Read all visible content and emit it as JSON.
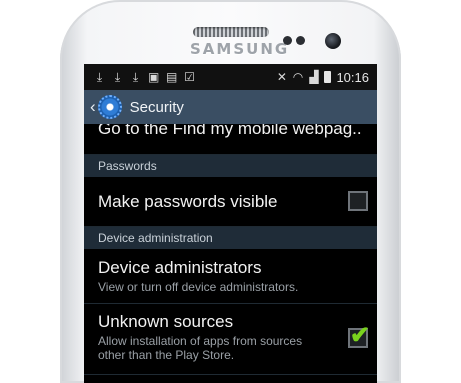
{
  "device": {
    "brand": "SAMSUNG"
  },
  "status_bar": {
    "time": "10:16",
    "left_icons": [
      "download-icon",
      "download-icon",
      "download-icon",
      "image-icon",
      "bag-icon",
      "clipboard-check-icon"
    ],
    "right_icons": [
      "mute-icon",
      "wifi-icon",
      "signal-icon",
      "battery-icon"
    ]
  },
  "action_bar": {
    "title": "Security",
    "accent": "#3a4e63"
  },
  "list": {
    "partial_item": "Go to the Find my mobile webpag..",
    "sections": [
      {
        "header": "Passwords"
      },
      {
        "header": "Device administration"
      }
    ],
    "items": {
      "make_passwords": {
        "title": "Make passwords visible",
        "checked": false
      },
      "device_admins": {
        "title": "Device administrators",
        "subtitle": "View or turn off device administrators."
      },
      "unknown_sources": {
        "title": "Unknown sources",
        "subtitle": "Allow installation of apps from sources other than the Play Store.",
        "checked": true
      }
    }
  }
}
